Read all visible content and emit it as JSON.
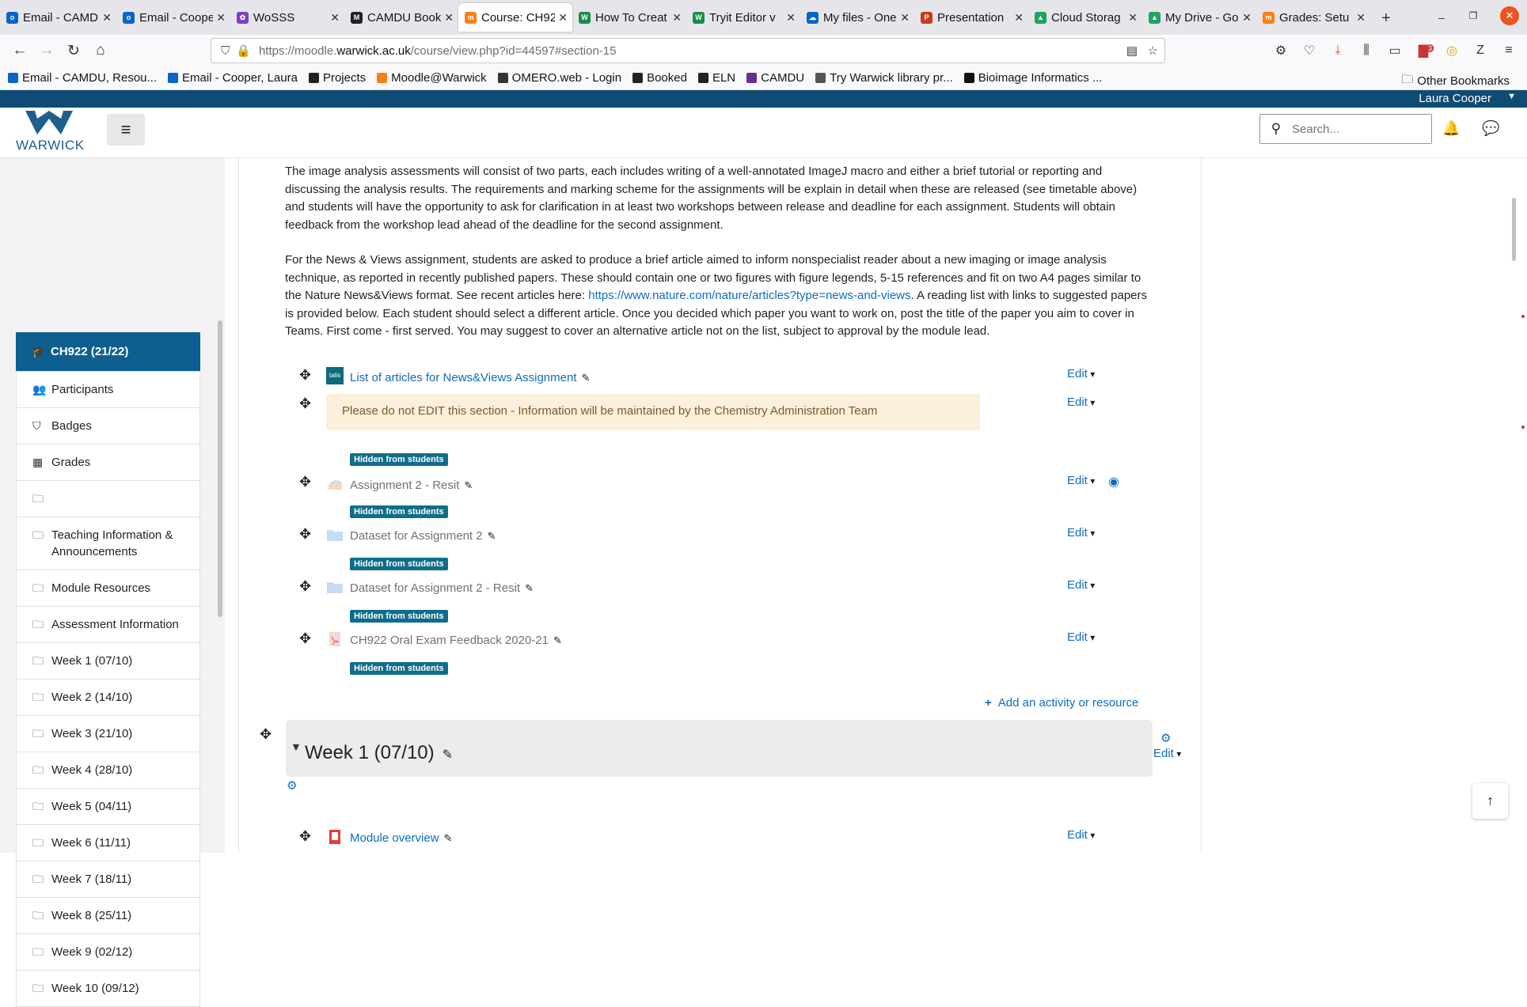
{
  "browser": {
    "tabs": [
      {
        "label": "Email - CAMD",
        "icon": "outlook-icon",
        "color": "#0a64c8",
        "glyph": "o"
      },
      {
        "label": "Email - Coope",
        "icon": "outlook-icon",
        "color": "#0a64c8",
        "glyph": "o"
      },
      {
        "label": "WoSSS",
        "icon": "wosss-icon",
        "color": "#7b3fbf",
        "glyph": "✿"
      },
      {
        "label": "CAMDU Booki",
        "icon": "camdu-icon",
        "color": "#222222",
        "glyph": "M"
      },
      {
        "label": "Course: CH92",
        "icon": "moodle-icon",
        "color": "#f98012",
        "glyph": "m",
        "active": true
      },
      {
        "label": "How To Creat",
        "icon": "warwick-w-icon",
        "color": "#1a8c4a",
        "glyph": "W"
      },
      {
        "label": "Tryit Editor v",
        "icon": "warwick-w-icon",
        "color": "#1a8c4a",
        "glyph": "W"
      },
      {
        "label": "My files - One",
        "icon": "onedrive-icon",
        "color": "#0a64c8",
        "glyph": "☁"
      },
      {
        "label": "Presentation",
        "icon": "powerpoint-icon",
        "color": "#c43e1c",
        "glyph": "P"
      },
      {
        "label": "Cloud Storag",
        "icon": "drive-icon",
        "color": "#1da462",
        "glyph": "▲"
      },
      {
        "label": "My Drive - Go",
        "icon": "drive-icon",
        "color": "#1da462",
        "glyph": "▲"
      },
      {
        "label": "Grades: Setu",
        "icon": "moodle-icon",
        "color": "#f98012",
        "glyph": "m"
      }
    ],
    "url_prefix": "https://moodle.",
    "url_domain": "warwick.ac.uk",
    "url_suffix": "/course/view.php?id=44597#section-15",
    "bookmarks": [
      {
        "label": "Email - CAMDU, Resou...",
        "color": "#0a64c8"
      },
      {
        "label": "Email - Cooper, Laura",
        "color": "#0a64c8"
      },
      {
        "label": "Projects",
        "color": "#222222"
      },
      {
        "label": "Moodle@Warwick",
        "color": "#f98012"
      },
      {
        "label": "OMERO.web - Login",
        "color": "#333333"
      },
      {
        "label": "Booked",
        "color": "#222222"
      },
      {
        "label": "ELN",
        "color": "#222222"
      },
      {
        "label": "CAMDU",
        "color": "#6a2c91"
      },
      {
        "label": "Try Warwick library pr...",
        "color": "#555555"
      },
      {
        "label": "Bioimage Informatics ...",
        "color": "#111111"
      }
    ],
    "other_bookmarks": "Other Bookmarks",
    "download_badge": "3"
  },
  "user": {
    "name": "Laura Cooper"
  },
  "header": {
    "logo_text": "WARWICK",
    "search_placeholder": "Search..."
  },
  "sidebar": {
    "items": [
      {
        "label": "CH922 (21/22)",
        "icon": "graduation-cap-icon",
        "glyph": "🎓"
      },
      {
        "label": "Participants",
        "icon": "users-icon",
        "glyph": "👥"
      },
      {
        "label": "Badges",
        "icon": "shield-icon",
        "glyph": "⛉"
      },
      {
        "label": "Grades",
        "icon": "table-icon",
        "glyph": "▦"
      },
      {
        "label": "",
        "icon": "folder-icon",
        "glyph": "🗀"
      },
      {
        "label": "Teaching Information & Announcements",
        "icon": "folder-icon",
        "glyph": "🗀"
      },
      {
        "label": "Module Resources",
        "icon": "folder-icon",
        "glyph": "🗀"
      },
      {
        "label": "Assessment Information",
        "icon": "folder-icon",
        "glyph": "🗀"
      },
      {
        "label": "Week 1 (07/10)",
        "icon": "folder-icon",
        "glyph": "🗀"
      },
      {
        "label": "Week 2 (14/10)",
        "icon": "folder-icon",
        "glyph": "🗀"
      },
      {
        "label": "Week 3 (21/10)",
        "icon": "folder-icon",
        "glyph": "🗀"
      },
      {
        "label": "Week 4 (28/10)",
        "icon": "folder-icon",
        "glyph": "🗀"
      },
      {
        "label": "Week 5 (04/11)",
        "icon": "folder-icon",
        "glyph": "🗀"
      },
      {
        "label": "Week 6 (11/11)",
        "icon": "folder-icon",
        "glyph": "🗀"
      },
      {
        "label": "Week 7 (18/11)",
        "icon": "folder-icon",
        "glyph": "🗀"
      },
      {
        "label": "Week 8 (25/11)",
        "icon": "folder-icon",
        "glyph": "🗀"
      },
      {
        "label": "Week 9 (02/12)",
        "icon": "folder-icon",
        "glyph": "🗀"
      },
      {
        "label": "Week 10 (09/12)",
        "icon": "folder-icon",
        "glyph": "🗀"
      }
    ]
  },
  "main": {
    "para1": "The image analysis assessments will consist of two parts, each includes writing of a well-annotated ImageJ macro and either a brief tutorial or reporting and discussing the analysis results. The requirements and marking scheme for the assignments will be explain in detail when these are released (see timetable above) and students will have the opportunity to ask for clarification in at least two workshops between release and deadline for each assignment. Students will obtain feedback from the workshop lead ahead of the deadline for the second assignment.",
    "para2_before": "For the News & Views assignment, students are asked to produce a brief article aimed to inform nonspecialist reader about a new imaging or image analysis technique, as reported in recently published papers. These should contain one or two figures with figure legends, 5-15 references and fit on two A4 pages similar to the Nature News&Views format. See recent articles here: ",
    "para2_link": "https://www.nature.com/nature/articles?type=news-and-views",
    "para2_after": ". A reading list with links to suggested papers is provided below. Each student should select a different article. Once you decided which paper you want to work on, post the title of the paper you aim to cover in Teams. First come - first served. You may suggest to cover an alternative article not on the list, subject to approval by the module lead.",
    "activities": {
      "list": "List of articles for News&Views Assignment",
      "notice": "Please do not EDIT this section - Information will be maintained by the Chemistry Administration Team",
      "a2resit": "Assignment 2 - Resit",
      "dataset": "Dataset for Assignment 2",
      "dataset_resit": "Dataset for Assignment 2 - Resit",
      "oral": "CH922 Oral Exam Feedback 2020-21",
      "module_overview": "Module overview"
    },
    "talis_label": "talis",
    "edit_label": "Edit",
    "hidden_label": "Hidden from students",
    "add_activity": "Add an activity or resource",
    "week_title": "Week 1 (07/10)"
  }
}
